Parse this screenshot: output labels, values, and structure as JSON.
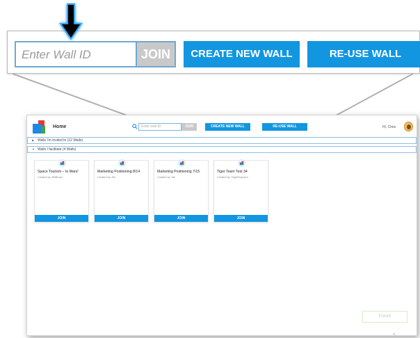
{
  "callout": {
    "wall_id_placeholder": "Enter Wall ID",
    "join_label": "JOIN",
    "create_label": "CREATE NEW WALL",
    "reuse_label": "RE-USE WALL"
  },
  "header": {
    "home_label": "Home",
    "wall_id_placeholder": "Enter wall ID",
    "join_label": "JOIN",
    "create_label": "CREATE NEW WALL",
    "reuse_label": "RE-USE WALL",
    "greeting": "Hi, Chris"
  },
  "sections": [
    {
      "label": "Walls I'm invited to (12 Walls)",
      "icon": "chevron-right-icon"
    },
    {
      "label": "Walls I facilitate (4 Walls)",
      "icon": "chevron-down-icon"
    }
  ],
  "cards": [
    {
      "title": "Space Tourism – to Mars!",
      "creator": "Created by: BillBrown",
      "join_label": "JOIN"
    },
    {
      "title": "Marketing Positioning 8/14",
      "creator": "Created by: Me",
      "join_label": "JOIN"
    },
    {
      "title": "Marketing Positioning 7/15",
      "creator": "Created by: Me",
      "join_label": "JOIN"
    },
    {
      "title": "Tiger Team Test 34",
      "creator": "Created by: OlgaFerguson",
      "join_label": "JOIN"
    }
  ],
  "footer": {
    "future_label": "Future",
    "corner_glyph": "⇖"
  },
  "colors": {
    "accent": "#1296e0",
    "join_disabled": "#c9c9c9",
    "input_border": "#6fa8d3"
  }
}
